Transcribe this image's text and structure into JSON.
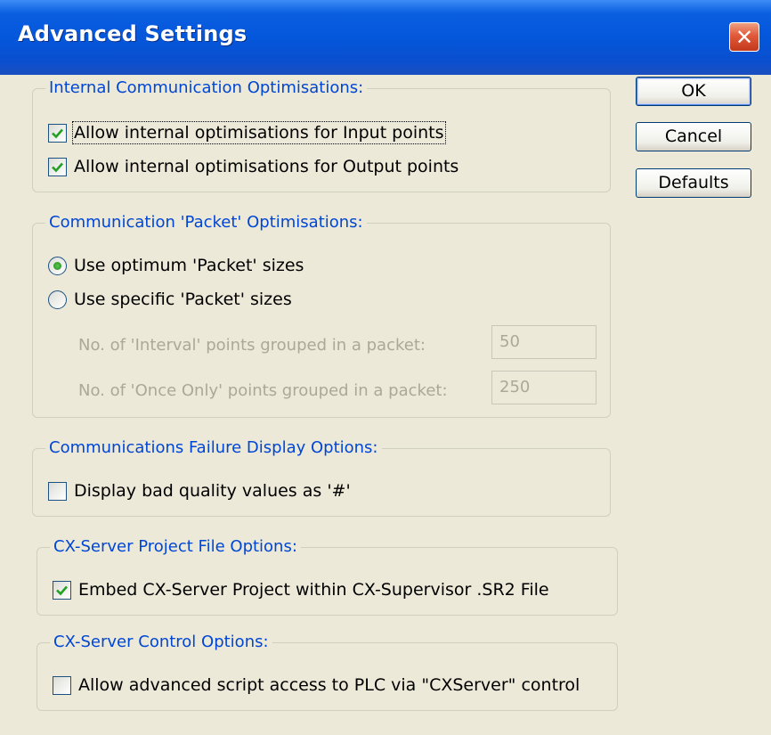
{
  "window": {
    "title": "Advanced Settings",
    "close_glyph": "✕"
  },
  "buttons": {
    "ok": "OK",
    "cancel": "Cancel",
    "defaults": "Defaults"
  },
  "internal": {
    "legend": "Internal Communication Optimisations:",
    "input_points": {
      "label": "Allow internal optimisations for Input points",
      "checked": true
    },
    "output_points": {
      "label": "Allow internal optimisations for Output points",
      "checked": true
    }
  },
  "packet": {
    "legend": "Communication 'Packet' Optimisations:",
    "optimum": {
      "label": "Use optimum 'Packet' sizes",
      "selected": true
    },
    "specific": {
      "label": "Use specific 'Packet' sizes",
      "selected": false
    },
    "interval_label": "No. of 'Interval' points grouped in a packet:",
    "interval_value": "50",
    "once_label": "No. of 'Once Only' points grouped in a packet:",
    "once_value": "250"
  },
  "failure": {
    "legend": "Communications Failure Display Options:",
    "bad_quality": {
      "label": "Display bad quality values as '#'",
      "checked": false
    }
  },
  "project": {
    "legend": "CX-Server Project File Options:",
    "embed": {
      "label": "Embed CX-Server Project within CX-Supervisor .SR2 File",
      "checked": true
    }
  },
  "control": {
    "legend": "CX-Server Control Options:",
    "script_access": {
      "label": "Allow advanced script access to PLC via \"CXServer\" control",
      "checked": false
    }
  },
  "colors": {
    "titlebar": "#0457db",
    "legend_text": "#0046d5",
    "dialog_bg": "#ECE9D8",
    "check_green": "#21a121"
  }
}
